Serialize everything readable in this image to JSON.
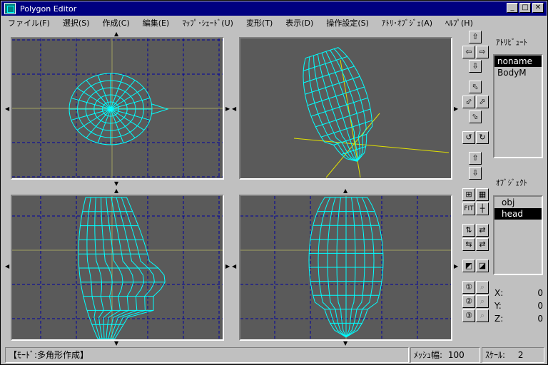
{
  "window": {
    "title": "Polygon Editor",
    "minimize": "_",
    "maximize": "□",
    "close": "✕"
  },
  "menu": [
    "ファイル(F)",
    "選択(S)",
    "作成(C)",
    "編集(E)",
    "ﾏｯﾌﾟ･ｼｪｰﾄﾞ(U)",
    "変形(T)",
    "表示(D)",
    "操作設定(S)",
    "ｱﾄﾘ･ｵﾌﾞｼﾞｪ(A)",
    "ﾍﾙﾌﾟ(H)"
  ],
  "attribute_panel": {
    "label": "ｱﾄﾘﾋﾞｭｰﾄ",
    "items": [
      "noname",
      "BodyM"
    ],
    "selected_index": 0
  },
  "object_panel": {
    "label": "ｵﾌﾞｼﾞｪｸﾄ",
    "items": [
      "obj",
      "head"
    ],
    "selected_index": 1
  },
  "coords": {
    "x_label": "X:",
    "x_value": "0",
    "y_label": "Y:",
    "y_value": "0",
    "z_label": "Z:",
    "z_value": "0"
  },
  "tools": {
    "fit_label": "FIT",
    "icons": [
      "up-arrow-icon",
      "left-arrow-icon",
      "right-arrow-icon",
      "down-arrow-icon",
      "rotate-up-left-icon",
      "rotate-left-icon",
      "rotate-right-icon",
      "rotate-down-icon",
      "rotate-ccw-icon",
      "rotate-cw-icon",
      "zoom-in-icon",
      "zoom-out-icon",
      "grid-icon",
      "grid-fine-icon",
      "fit-icon",
      "crosshair-icon",
      "swap-xy-icon",
      "swap-x-icon",
      "swap-y-icon",
      "swap-z-icon",
      "snapshot-icon",
      "snapshot-2-icon",
      "mode-1-icon",
      "mode-1-disabled-icon",
      "mode-2-icon",
      "mode-2-disabled-icon",
      "mode-3-icon",
      "mode-3-disabled-icon"
    ]
  },
  "status": {
    "mode": "【ﾓｰﾄﾞ:多角形作成】",
    "mesh_label": "ﾒｯｼｭ幅:",
    "mesh_value": "100",
    "scale_label": "ｽｹｰﾙ:",
    "scale_value": "2"
  },
  "colors": {
    "viewport_bg": "#5a5a5a",
    "wire": "#00ffff",
    "grid": "#0000a0",
    "axis": "#e0e000",
    "titlebar": "#000080"
  }
}
